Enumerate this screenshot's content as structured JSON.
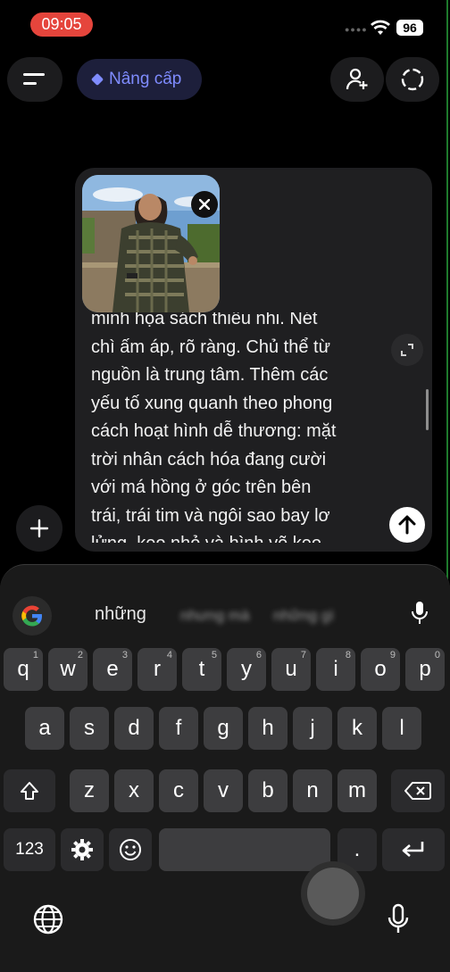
{
  "status_bar": {
    "time": "09:05",
    "battery": "96"
  },
  "header": {
    "upgrade_label": "Nâng cấp"
  },
  "composer": {
    "text_lines": [
      "minh họa sách thiếu nhi. Nét",
      "chì ấm áp, rõ ràng. Chủ thể từ",
      "nguồn là trung tâm. Thêm các",
      "yếu tố xung quanh theo phong",
      "cách hoạt hình dễ thương: mặt",
      "trời nhân cách hóa đang cười",
      "với má hồng ở góc trên bên",
      "trái, trái tim và ngôi sao bay lơ",
      "lửng, kẹo nhỏ và hình vẽ kẹo"
    ]
  },
  "keyboard": {
    "suggestion": "những",
    "blurred_suggestions": [
      "nhưng mà",
      "những gì"
    ],
    "row1": [
      {
        "key": "q",
        "hint": "1"
      },
      {
        "key": "w",
        "hint": "2"
      },
      {
        "key": "e",
        "hint": "3"
      },
      {
        "key": "r",
        "hint": "4"
      },
      {
        "key": "t",
        "hint": "5"
      },
      {
        "key": "y",
        "hint": "6"
      },
      {
        "key": "u",
        "hint": "7"
      },
      {
        "key": "i",
        "hint": "8"
      },
      {
        "key": "o",
        "hint": "9"
      },
      {
        "key": "p",
        "hint": "0"
      }
    ],
    "row2": [
      "a",
      "s",
      "d",
      "f",
      "g",
      "h",
      "j",
      "k",
      "l"
    ],
    "row3": [
      "z",
      "x",
      "c",
      "v",
      "b",
      "n",
      "m"
    ],
    "num_label": "123",
    "period": "."
  },
  "colors": {
    "accent": "#7f8cff",
    "time_pill": "#e5453c",
    "upgrade_bg": "#1d1f3b"
  }
}
